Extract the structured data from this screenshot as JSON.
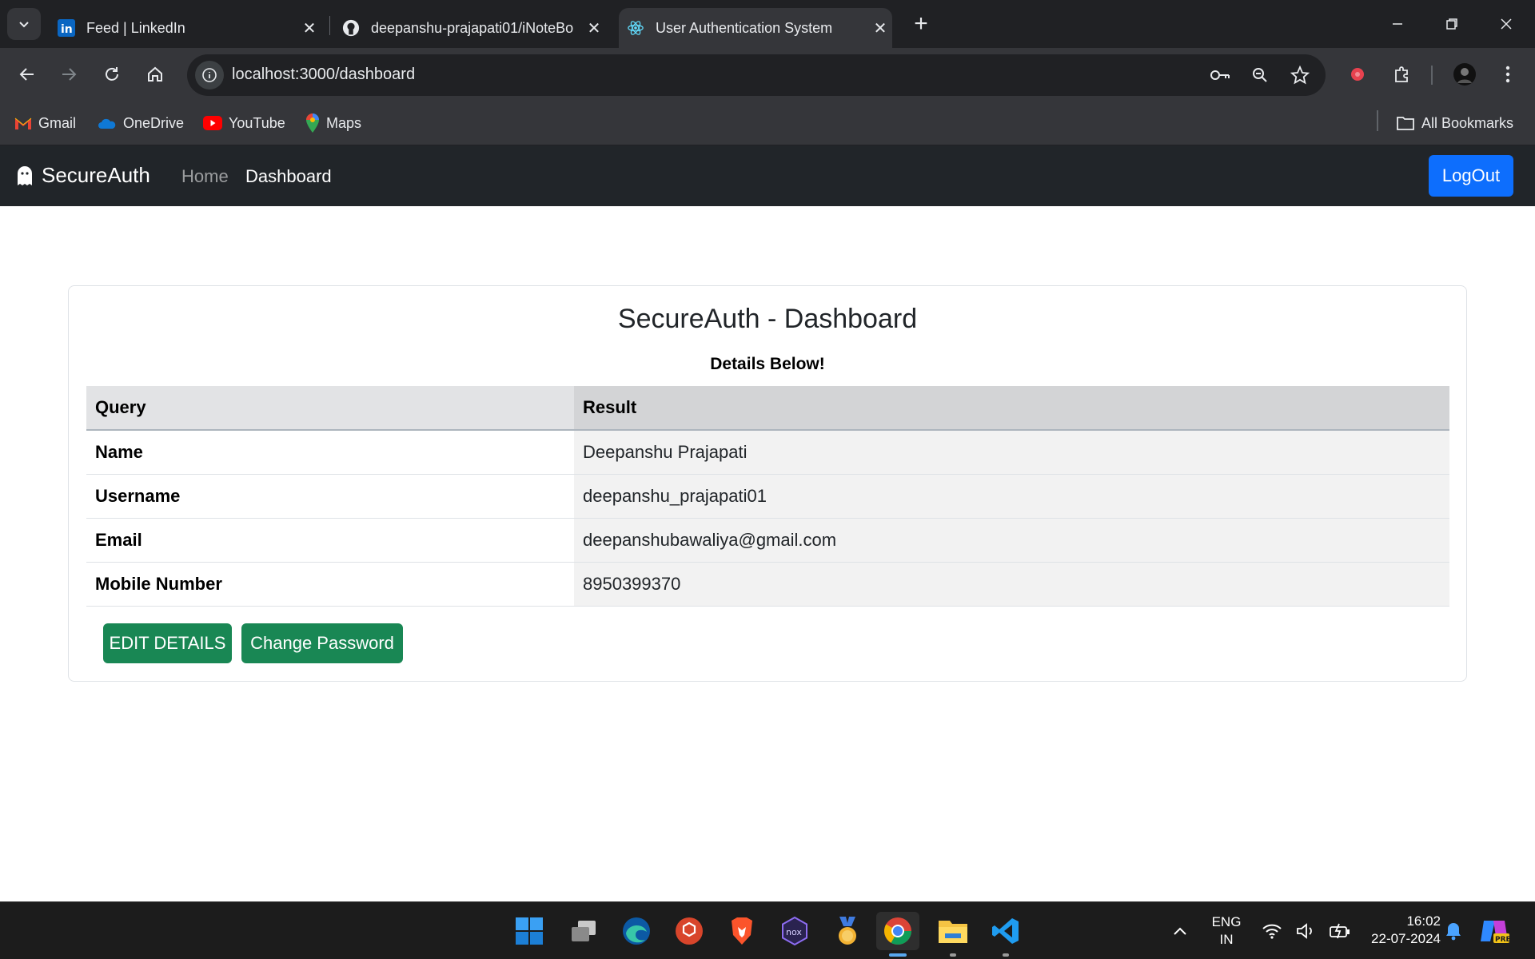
{
  "browser": {
    "tabs": [
      {
        "title": "Feed | LinkedIn",
        "icon": "linkedin-icon"
      },
      {
        "title": "deepanshu-prajapati01/iNoteBo",
        "icon": "github-icon"
      },
      {
        "title": "User Authentication System",
        "icon": "react-icon",
        "active": true
      }
    ],
    "url": "localhost:3000/dashboard",
    "bookmarks": [
      {
        "label": "Gmail"
      },
      {
        "label": "OneDrive"
      },
      {
        "label": "YouTube"
      },
      {
        "label": "Maps"
      }
    ],
    "all_bookmarks": "All Bookmarks"
  },
  "app": {
    "brand": "SecureAuth",
    "nav": {
      "home": "Home",
      "dashboard": "Dashboard"
    },
    "logout": "LogOut",
    "card": {
      "title": "SecureAuth - Dashboard",
      "subtitle": "Details Below!",
      "headers": {
        "query": "Query",
        "result": "Result"
      },
      "rows": [
        {
          "query": "Name",
          "result": "Deepanshu Prajapati"
        },
        {
          "query": "Username",
          "result": "deepanshu_prajapati01"
        },
        {
          "query": "Email",
          "result": "deepanshubawaliya@gmail.com"
        },
        {
          "query": "Mobile Number",
          "result": "8950399370"
        }
      ],
      "edit_button": "EDIT DETAILS",
      "password_button": "Change Password"
    }
  },
  "colors": {
    "navbar": "#212529",
    "primary": "#0d6efd",
    "success": "#198754"
  },
  "taskbar": {
    "lang": "ENG",
    "region": "IN",
    "time": "16:02",
    "date": "22-07-2024"
  }
}
